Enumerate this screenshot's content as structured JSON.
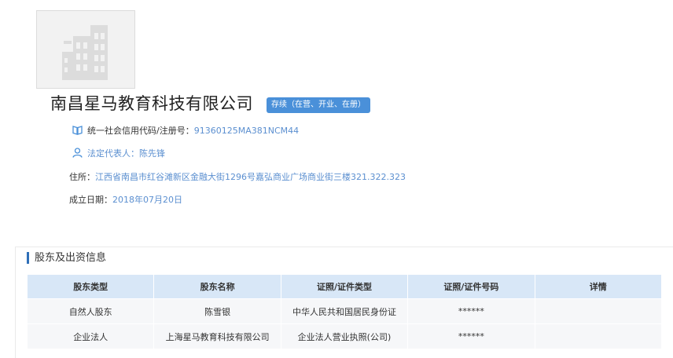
{
  "company": {
    "logo_icon": "building-icon",
    "name": "南昌星马教育科技有限公司",
    "status": "存续（在营、开业、在册）"
  },
  "info": {
    "credit_label": "统一社会信用代码/注册号：",
    "credit_value": "91360125MA381NCM44",
    "legal_label": "法定代表人：",
    "legal_value": "陈先锋",
    "address_label": "住所：",
    "address_value": "江西省南昌市红谷滩新区金融大街1296号嘉弘商业广场商业街三楼321.322.323",
    "date_label": "成立日期：",
    "date_value": "2018年07月20日"
  },
  "shareholders": {
    "title": "股东及出资信息",
    "headers": [
      "股东类型",
      "股东名称",
      "证照/证件类型",
      "证照/证件号码",
      "详情"
    ],
    "rows": [
      [
        "自然人股东",
        "陈雪银",
        "中华人民共和国居民身份证",
        "******",
        ""
      ],
      [
        "企业法人",
        "上海星马教育科技有限公司",
        "企业法人营业执照(公司)",
        "******",
        ""
      ]
    ]
  },
  "colors": {
    "accent": "#4a90d9",
    "link": "#5b8fd0",
    "header_bg": "#d8e7f7",
    "section_bar": "#2f6fb8"
  }
}
